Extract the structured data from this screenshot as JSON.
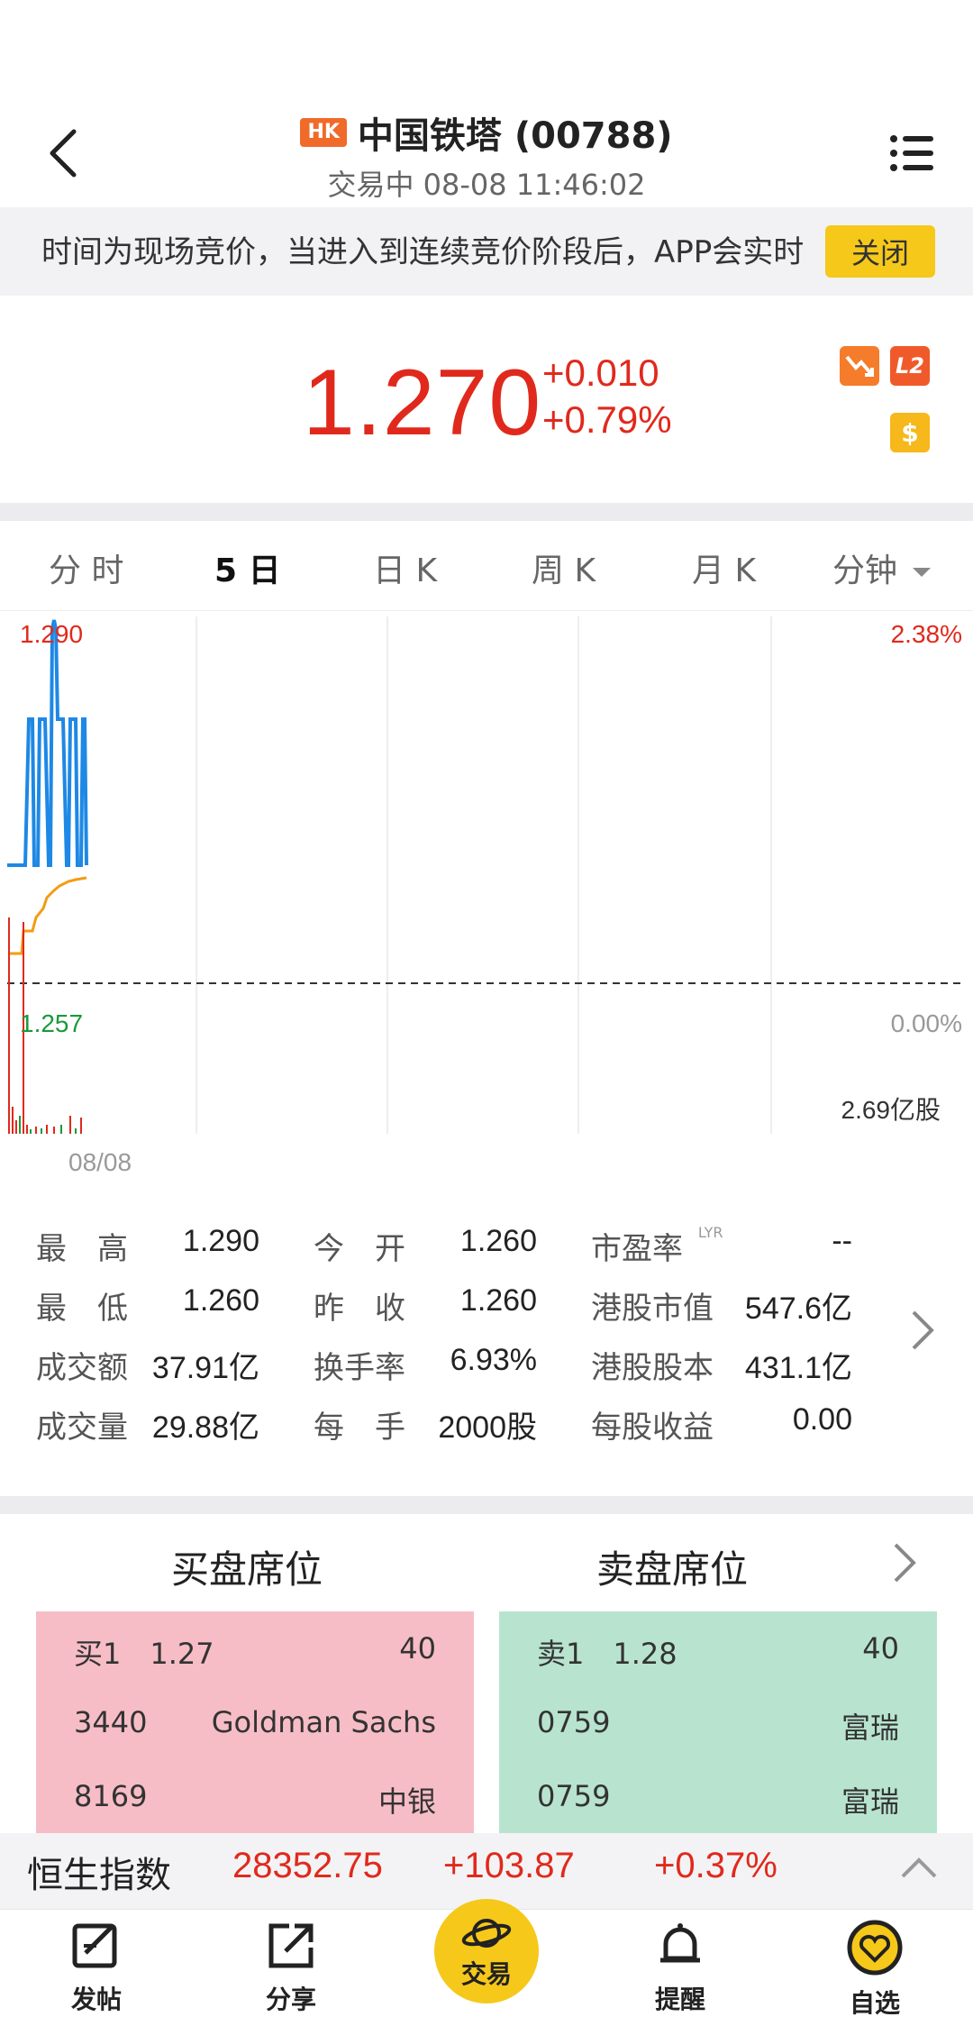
{
  "header": {
    "market_badge": "HK",
    "title": "中国铁塔 (00788)",
    "subtitle": "交易中 08-08 11:46:02"
  },
  "notice": {
    "text": "时间为现场竞价，当进入到连续竞价阶段后，APP会实时",
    "close_label": "关闭"
  },
  "quote": {
    "price": "1.270",
    "change": "+0.010",
    "change_pct": "+0.79%",
    "l2_label": "L2",
    "dollar_label": "$"
  },
  "tabs": [
    {
      "label": "分 时"
    },
    {
      "label": "5 日"
    },
    {
      "label": "日 K"
    },
    {
      "label": "周 K"
    },
    {
      "label": "月 K"
    },
    {
      "label": "分钟"
    }
  ],
  "chart": {
    "high_label": "1.290",
    "low_label": "1.257",
    "pct_high": "2.38%",
    "pct_zero": "0.00%",
    "volume_label": "2.69亿股",
    "date_label": "08/08"
  },
  "stats": [
    {
      "label": "最　高",
      "value": "1.290"
    },
    {
      "label": "今　开",
      "value": "1.260"
    },
    {
      "label": "市盈率",
      "sup": "LYR",
      "value": "--"
    },
    {
      "label": "最　低",
      "value": "1.260"
    },
    {
      "label": "昨　收",
      "value": "1.260"
    },
    {
      "label": "港股市值",
      "value": "547.6亿"
    },
    {
      "label": "成交额",
      "value": "37.91亿"
    },
    {
      "label": "换手率",
      "value": "6.93%"
    },
    {
      "label": "港股股本",
      "value": "431.1亿"
    },
    {
      "label": "成交量",
      "value": "29.88亿"
    },
    {
      "label": "每　手",
      "value": "2000股"
    },
    {
      "label": "每股收益",
      "value": "0.00"
    }
  ],
  "seats": {
    "buy_title": "买盘席位",
    "sell_title": "卖盘席位",
    "buy_rows": [
      {
        "left": "买1　1.27",
        "right": "40"
      },
      {
        "left": "3440",
        "right": "Goldman Sachs"
      },
      {
        "left": "8169",
        "right": "中银"
      }
    ],
    "sell_rows": [
      {
        "left": "卖1　1.28",
        "right": "40"
      },
      {
        "left": "0759",
        "right": "富瑞"
      },
      {
        "left": "0759",
        "right": "富瑞"
      }
    ]
  },
  "index_bar": {
    "name": "恒生指数",
    "value": "28352.75",
    "change": "+103.87",
    "change_pct": "+0.37%"
  },
  "nav": [
    {
      "label": "发帖",
      "icon": "edit-icon"
    },
    {
      "label": "分享",
      "icon": "share-icon"
    },
    {
      "label": "交易",
      "icon": "trade-planet-icon"
    },
    {
      "label": "提醒",
      "icon": "bell-icon"
    },
    {
      "label": "自选",
      "icon": "heart-icon"
    }
  ],
  "colors": {
    "up": "#e0291c",
    "down": "#1a9a3a",
    "accent": "#f6c81a",
    "price_line": "#1e88e5",
    "avg_line": "#f39c12"
  }
}
